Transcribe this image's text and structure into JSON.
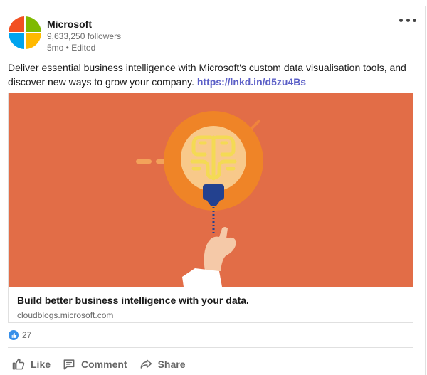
{
  "post": {
    "author": {
      "name": "Microsoft",
      "followers": "9,633,250 followers",
      "meta": "5mo • Edited",
      "logo_colors": [
        "#f25022",
        "#7fba00",
        "#00a4ef",
        "#ffb900"
      ]
    },
    "menu_icon": "more-horizontal-icon",
    "commentary": {
      "text": "Deliver essential business intelligence with Microsoft's custom data visualisation tools, and discover new ways to grow your company.",
      "link": "https://lnkd.in/d5zu4Bs"
    },
    "article": {
      "title": "Build better business intelligence with your data.",
      "source": "cloudblogs.microsoft.com",
      "image_icon": "brain-lightbulb-icon",
      "image_colors": {
        "background": "#e26d47",
        "glow": "#ef8427",
        "bulb": "#f8c98a",
        "brain": "#f4da54",
        "socket": "#23418f",
        "skin": "#f5c9a8"
      }
    },
    "reactions": {
      "count": "27",
      "icon": "like-reaction-icon",
      "color": "#378fe9"
    },
    "actions": [
      {
        "label": "Like",
        "icon": "thumbs-up-icon"
      },
      {
        "label": "Comment",
        "icon": "comment-icon"
      },
      {
        "label": "Share",
        "icon": "share-icon"
      }
    ]
  }
}
